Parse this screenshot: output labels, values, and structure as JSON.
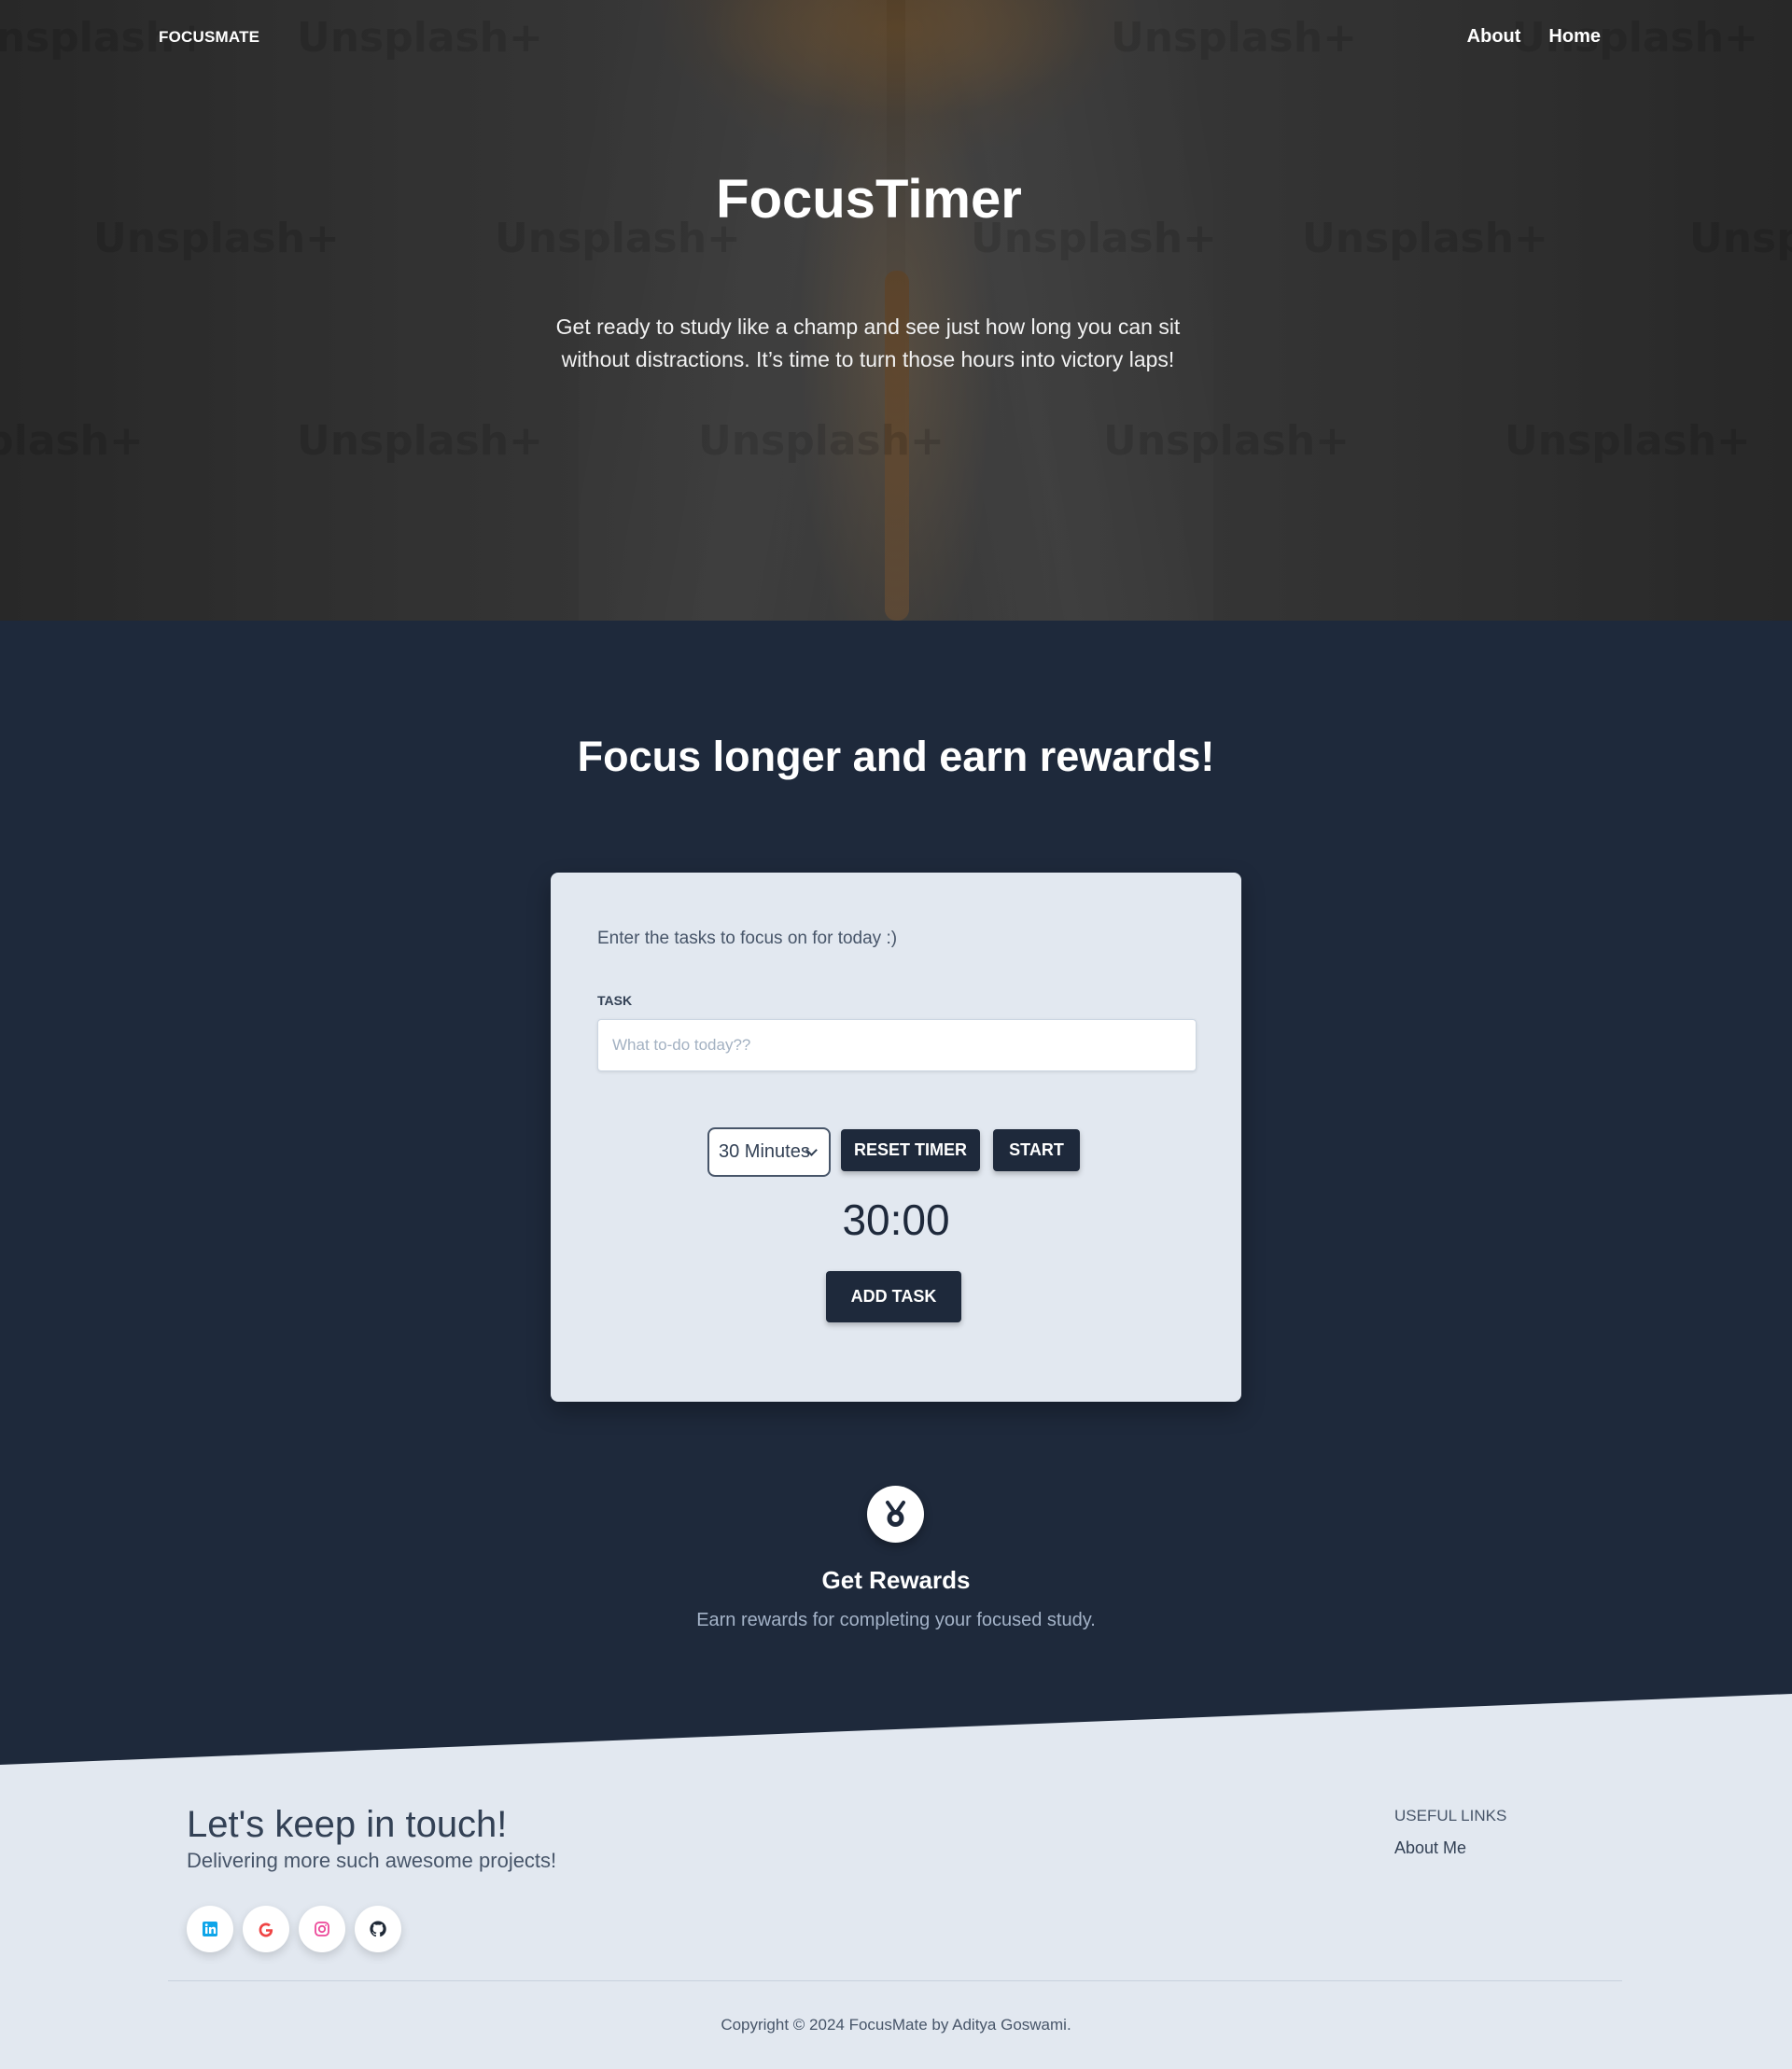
{
  "header": {
    "brand": "FOCUSMATE",
    "nav": [
      "About",
      "Home"
    ]
  },
  "hero": {
    "title": "FocusTimer",
    "subtitle": "Get ready to study like a champ and see just how long you can sit without distractions. It’s time to turn those hours into victory laps!",
    "watermark": "Unsplash+"
  },
  "main": {
    "heading": "Focus longer and earn rewards!",
    "card": {
      "intro": "Enter the tasks to focus on for today :)",
      "task_label": "TASK",
      "task_placeholder": "What to-do today??",
      "task_value": "",
      "duration_selected": "30 Minutes",
      "reset_label": "RESET TIMER",
      "start_label": "START",
      "timer_display": "30:00",
      "add_label": "ADD TASK"
    },
    "reward": {
      "icon": "medal-icon",
      "title": "Get Rewards",
      "subtitle": "Earn rewards for completing your focused study."
    }
  },
  "footer": {
    "title": "Let's keep in touch!",
    "subtitle": "Delivering more such awesome projects!",
    "social": [
      {
        "icon": "linkedin-icon",
        "color": "#0ea5e9"
      },
      {
        "icon": "google-icon",
        "color": "#ef4444"
      },
      {
        "icon": "instagram-icon",
        "color": "#ec4899"
      },
      {
        "icon": "github-icon",
        "color": "#1f2937"
      }
    ],
    "useful_links_heading": "USEFUL LINKS",
    "useful_links": [
      "About Me"
    ],
    "copyright": "Copyright © 2024 FocusMate by Aditya Goswami."
  },
  "colors": {
    "dark_bg": "#1e293b",
    "light_bg": "#e2e8f0",
    "button_bg": "#1e293b"
  }
}
